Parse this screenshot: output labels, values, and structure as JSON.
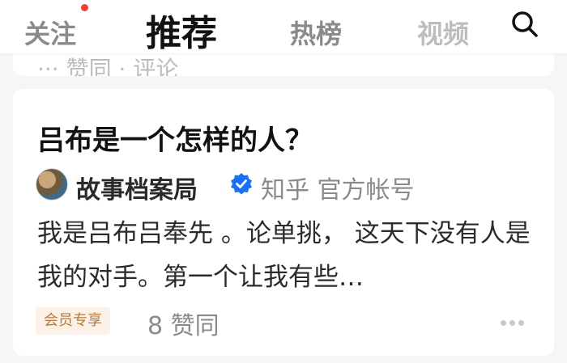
{
  "nav": {
    "tabs": [
      "关注",
      "推荐",
      "热榜",
      "视频"
    ],
    "active": "推荐",
    "has_notification_dot": true,
    "search_icon": "search-icon"
  },
  "prev_card": {
    "meta": "··· 赞同 · 评论"
  },
  "card": {
    "title": "吕布是一个怎样的人？",
    "author_name": "故事档案局",
    "author_verified_icon": "verified-badge-icon",
    "author_tag": "知乎 官方帐号",
    "excerpt": "我是吕布吕奉先 。论单挑， 这天下没有人是我的对手。第一个让我有些…",
    "vip_badge": "会员专享",
    "likes": "8 赞同",
    "more_icon": "more-dots-icon"
  },
  "colors": {
    "active_tab": "#121212",
    "inactive_tab": "#8a8a8a",
    "notification_dot": "#f1403c",
    "verified_blue": "#1772f6",
    "vip_bg": "#fbf1e6",
    "vip_text": "#b87a3a"
  }
}
